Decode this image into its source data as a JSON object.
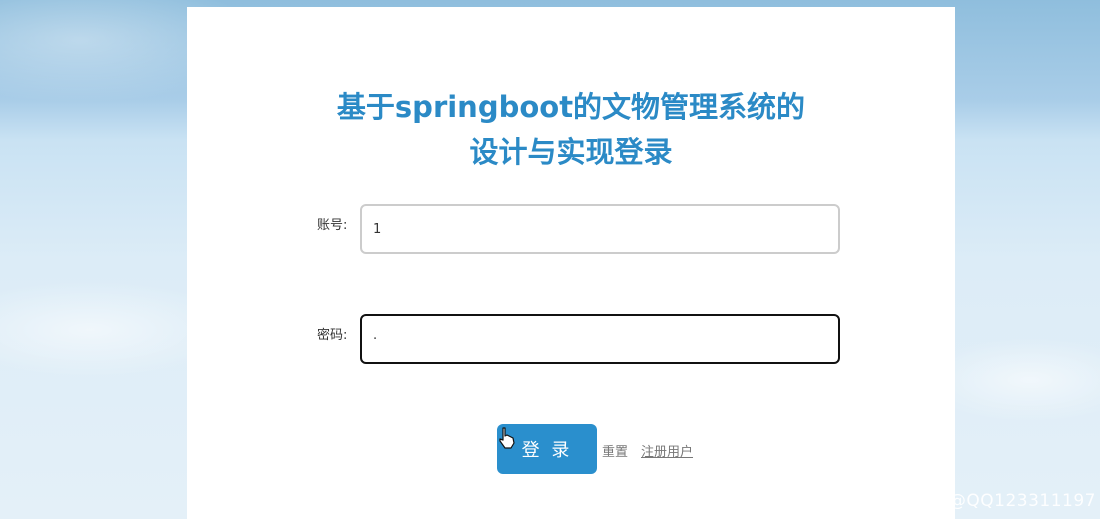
{
  "login": {
    "title_line1": "基于springboot的文物管理系统的",
    "title_line2": "设计与实现登录",
    "account_label": "账号:",
    "account_value": "1",
    "password_label": "密码:",
    "password_value": "·",
    "login_button": "登 录",
    "reset_link": "重置",
    "register_link": "注册用户"
  },
  "watermark": "CSDN @QQ123311197",
  "colors": {
    "title": "#2b8ac6",
    "button": "#2a8fcd"
  }
}
